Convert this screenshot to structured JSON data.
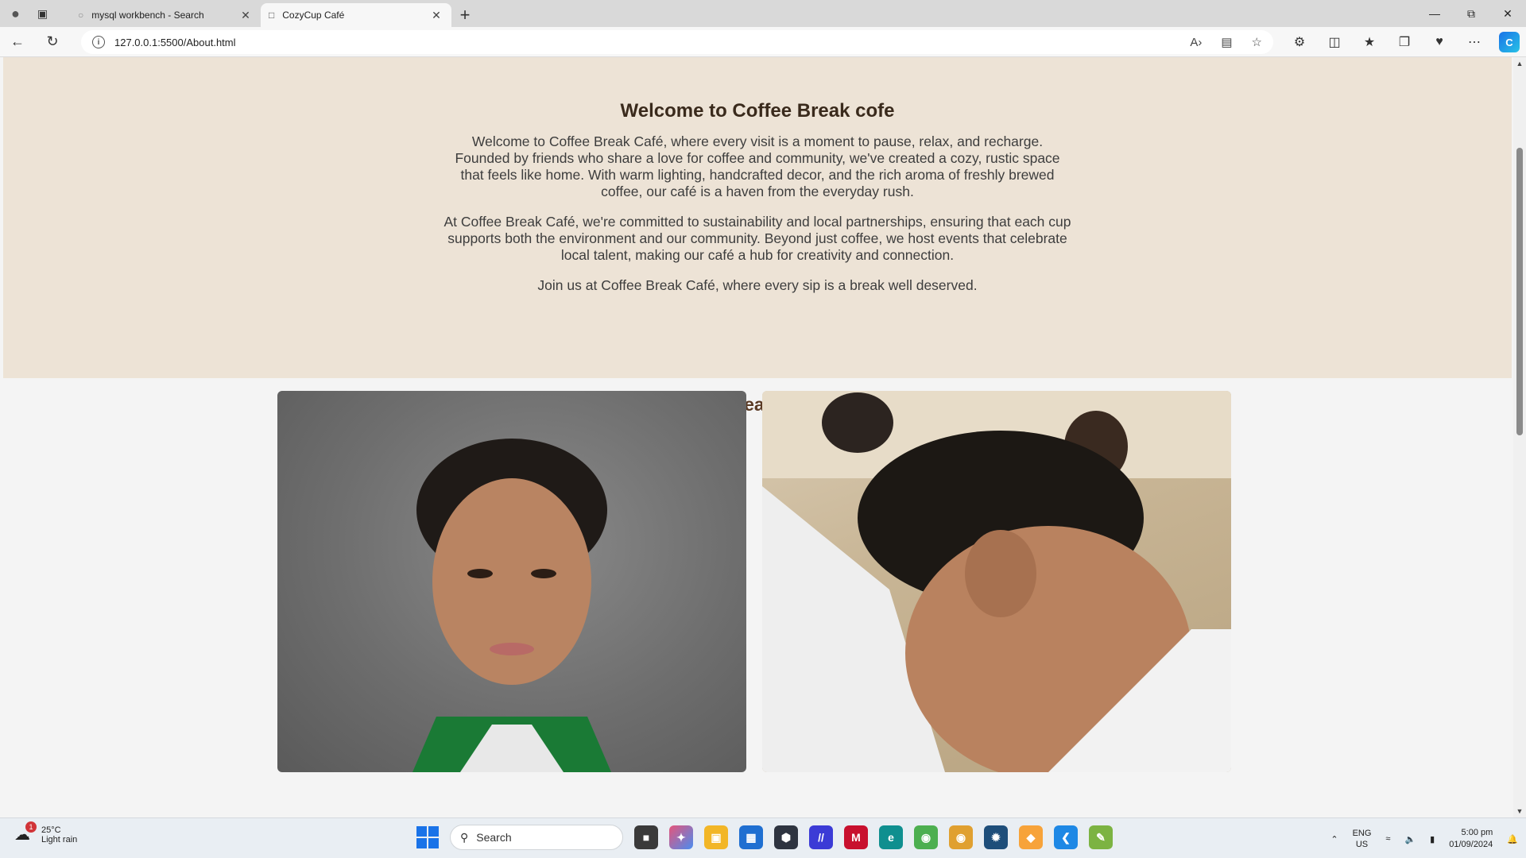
{
  "browser": {
    "tabs": [
      {
        "title": "mysql workbench - Search",
        "active": false
      },
      {
        "title": "CozyCup Café",
        "active": true
      }
    ],
    "url": "127.0.0.1:5500/About.html"
  },
  "page": {
    "hero": {
      "title": "Welcome to Coffee Break cofe",
      "paragraphs": [
        "Welcome to Coffee Break Café, where every visit is a moment to pause, relax, and recharge. Founded by friends who share a love for coffee and community, we've created a cozy, rustic space that feels like home. With warm lighting, handcrafted decor, and the rich aroma of freshly brewed coffee, our café is a haven from the everyday rush.",
        "At Coffee Break Café, we're committed to sustainability and local partnerships, ensuring that each cup supports both the environment and our community. Beyond just coffee, we host events that celebrate local talent, making our café a hub for creativity and connection.",
        "Join us at Coffee Break Café, where every sip is a break well deserved."
      ]
    },
    "team": {
      "heading": "Team"
    }
  },
  "taskbar": {
    "weather": {
      "temp": "25°C",
      "condition": "Light rain",
      "badge": "1"
    },
    "search_placeholder": "Search",
    "lang": {
      "line1": "ENG",
      "line2": "US"
    },
    "time": "5:00 pm",
    "date": "01/09/2024"
  },
  "colors": {
    "hero_bg": "#ede3d6",
    "heading": "#3a2a1c",
    "team_heading": "#5a3a24"
  }
}
